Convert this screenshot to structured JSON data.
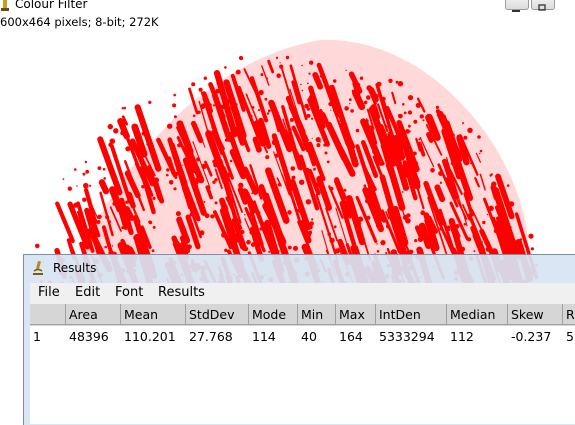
{
  "colour_window": {
    "title": "Colour Filter",
    "info": "600x464 pixels; 8-bit; 272K"
  },
  "colors": {
    "blob_red": "#ff0000",
    "results_bg": "#d7e4f2",
    "header_gray": "#d6d6d6"
  },
  "results_window": {
    "title": "Results",
    "menu": [
      "File",
      "Edit",
      "Font",
      "Results"
    ],
    "columns": [
      "",
      "Area",
      "Mean",
      "StdDev",
      "Mode",
      "Min",
      "Max",
      "IntDen",
      "Median",
      "Skew",
      "R"
    ],
    "rows": [
      [
        "1",
        "48396",
        "110.201",
        "27.768",
        "114",
        "40",
        "164",
        "5333294",
        "112",
        "-0.237",
        "5"
      ]
    ]
  }
}
